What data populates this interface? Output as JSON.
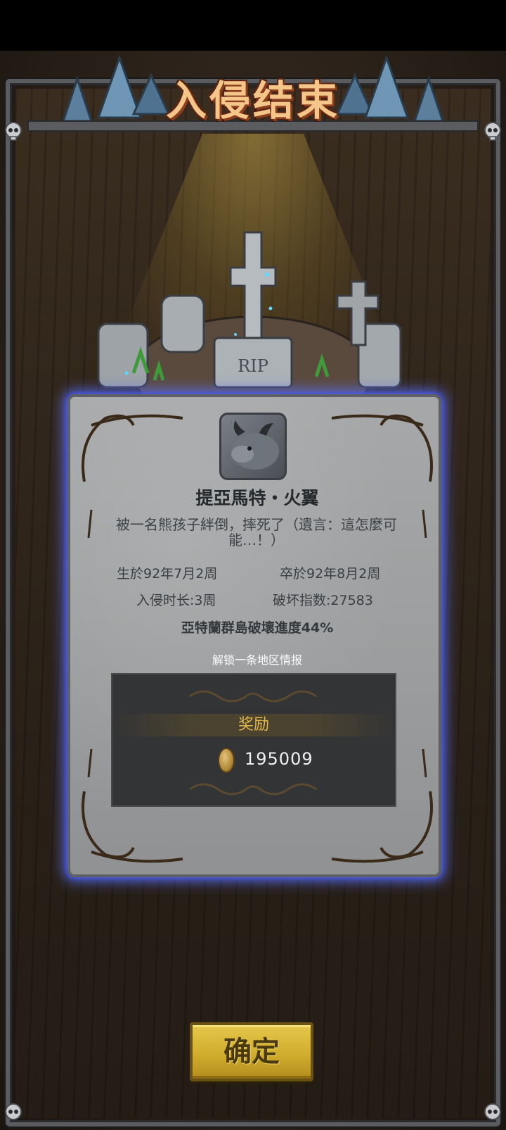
{
  "title": "入侵结束",
  "graves": {
    "tombstone_text": "RIP"
  },
  "character": {
    "name": "提亞馬特・火翼",
    "death_description": "被一名熊孩子絆倒，摔死了（遺言：這怎麼可能…！）"
  },
  "stats": {
    "born": "生於92年7月2周",
    "died": "卒於92年8月2周",
    "duration": "入侵时长:3周",
    "destruction_index": "破坏指数:27583"
  },
  "progress_text": "亞特蘭群島破壞進度44%",
  "unlock_text": "解锁一条地区情报",
  "reward": {
    "label": "奖励",
    "amount": "195009",
    "icon": "coin-icon"
  },
  "confirm_label": "确定",
  "colors": {
    "title": "#f4c68a",
    "panel_glow": "#5a6eff",
    "reward_label": "#e2b64a",
    "button": "#d1ad2e"
  }
}
